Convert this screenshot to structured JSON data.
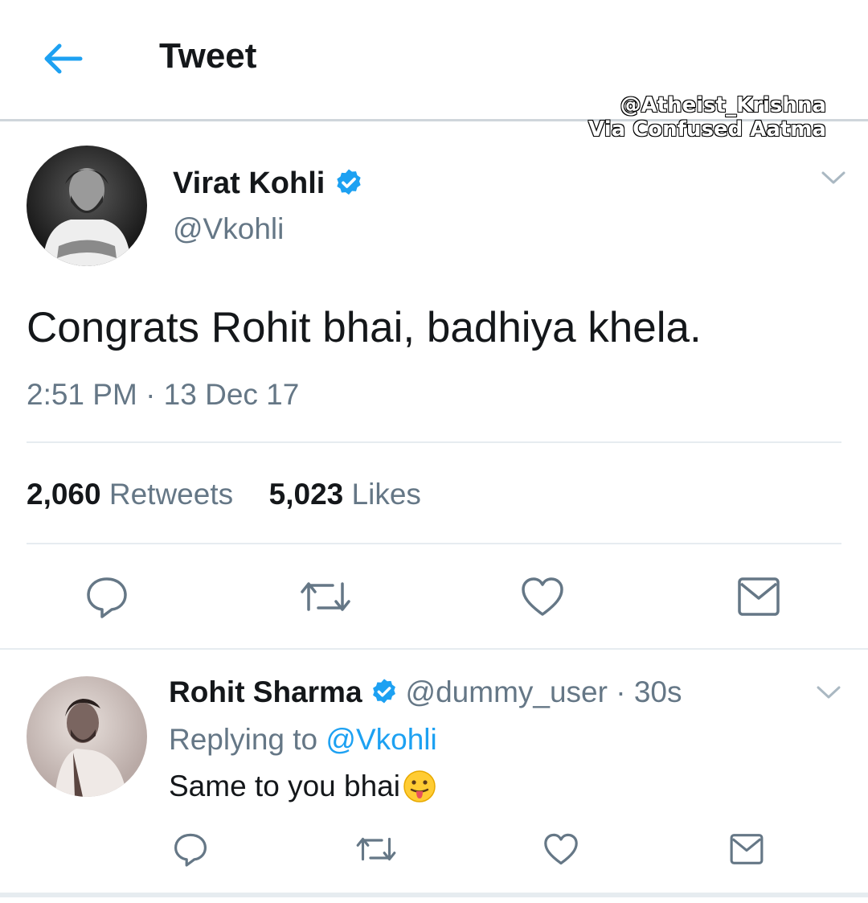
{
  "header": {
    "title": "Tweet"
  },
  "watermark": {
    "line1": "@Atheist_Krishna",
    "line2": "Via Confused Aatma"
  },
  "tweet": {
    "author_name": "Virat Kohli",
    "author_handle": "@Vkohli",
    "text": "Congrats Rohit bhai, badhiya khela.",
    "timestamp": "2:51 PM · 13 Dec 17",
    "retweets_count": "2,060",
    "retweets_label": "Retweets",
    "likes_count": "5,023",
    "likes_label": "Likes"
  },
  "reply": {
    "author_name": "Rohit Sharma",
    "handle_and_time": "@dummy_user · 30s",
    "replying_prefix": "Replying to",
    "replying_to": "@Vkohli",
    "text": "Same to you bhai"
  },
  "icons": {
    "back": "arrow-left-icon",
    "verified": "verified-badge-icon",
    "caret": "chevron-down-icon",
    "reply": "reply-bubble-icon",
    "retweet": "retweet-icon",
    "like": "heart-icon",
    "dm": "envelope-icon",
    "emoji": "face-with-tongue-emoji"
  },
  "colors": {
    "accent": "#1da1f2",
    "secondary_text": "#657786",
    "primary_text": "#14171a",
    "divider": "#e6ecf0"
  }
}
